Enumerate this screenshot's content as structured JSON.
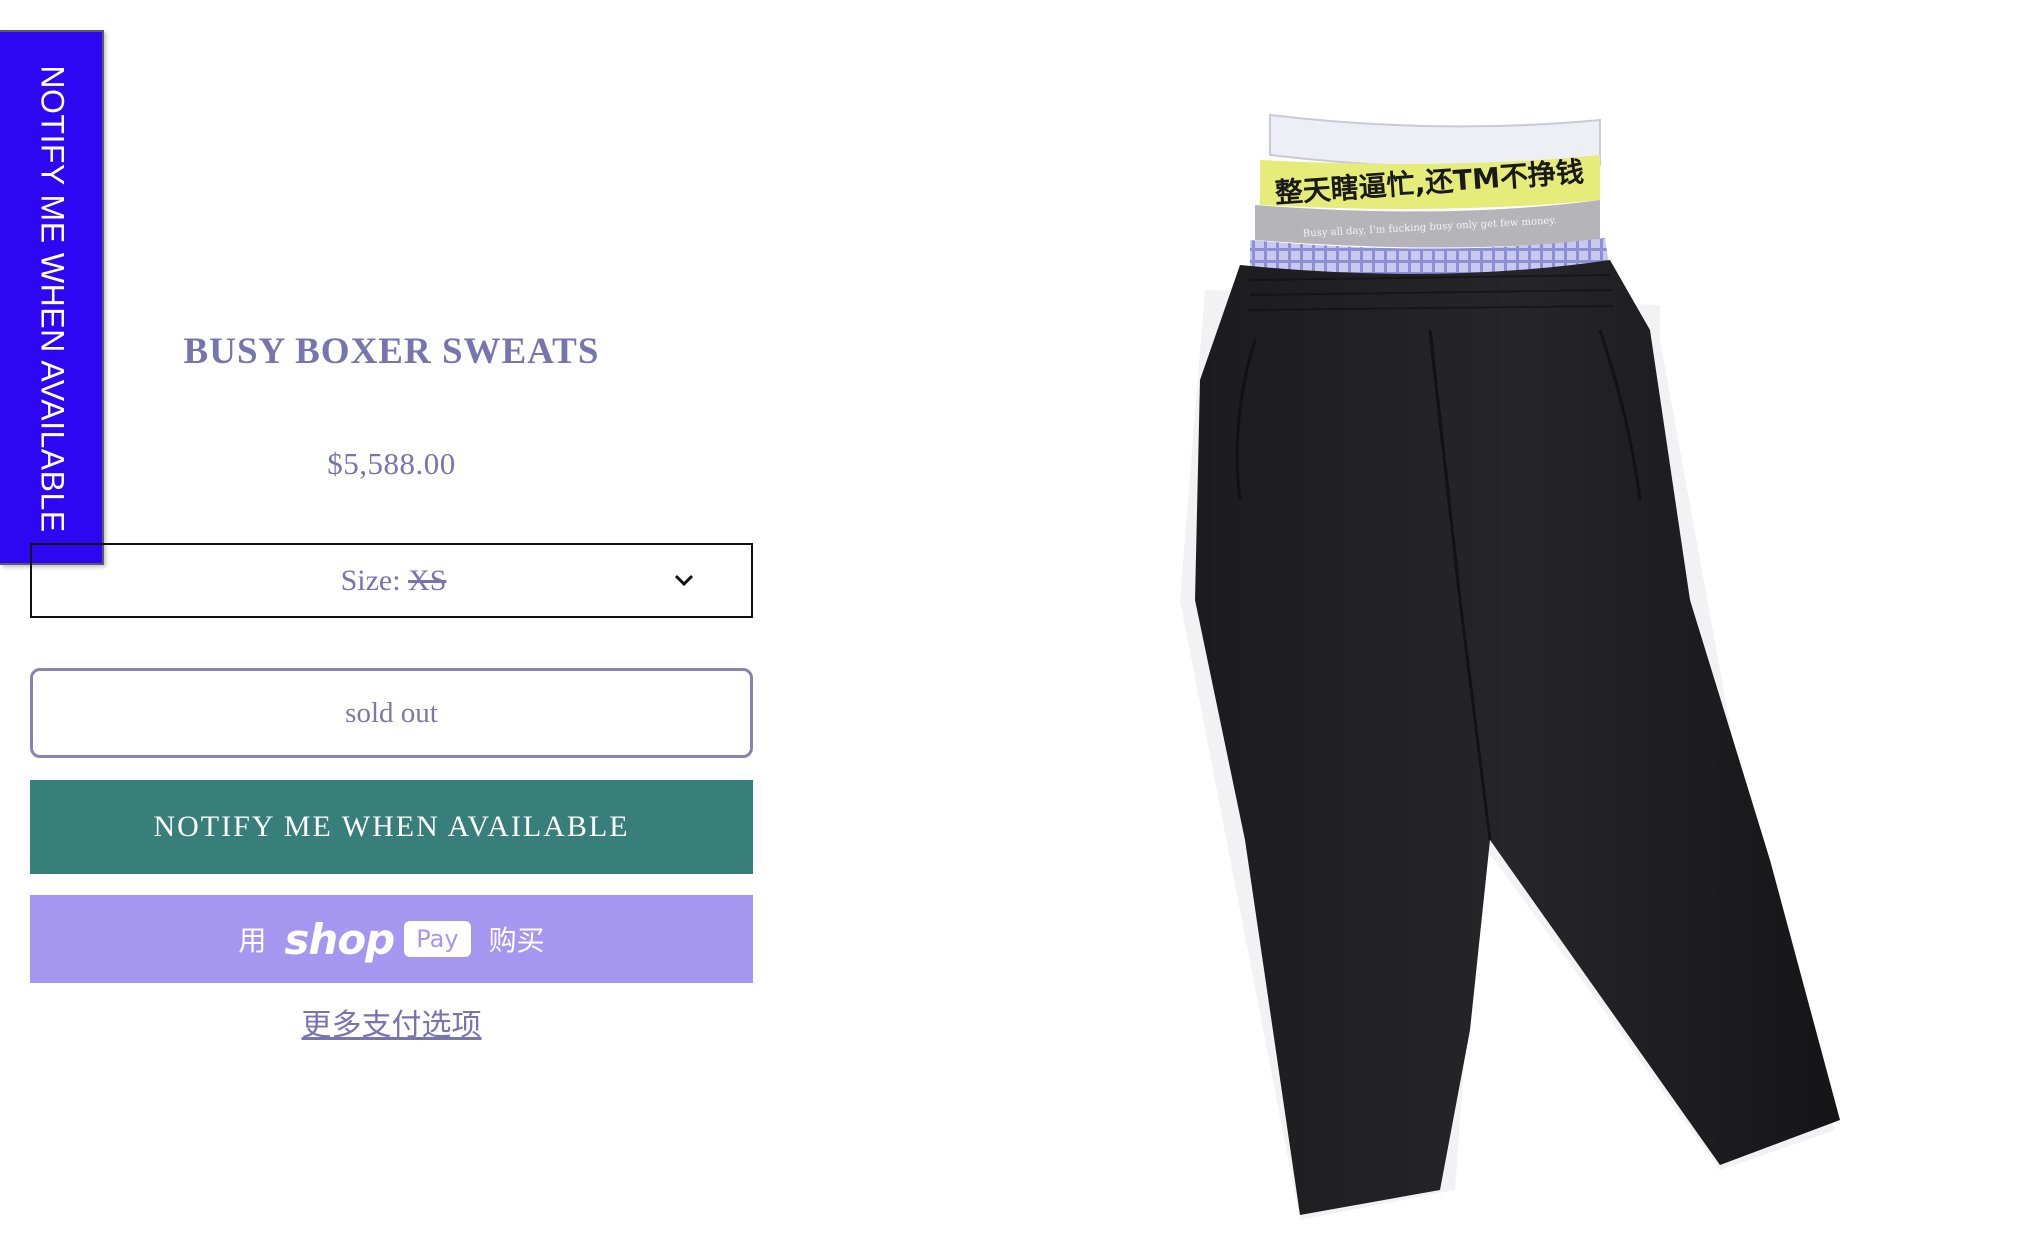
{
  "side_tab": {
    "label": "NOTIFY ME WHEN AVAILABLE"
  },
  "product": {
    "title": "BUSY BOXER SWEATS",
    "price": "$5,588.00",
    "size_label": "Size:",
    "size_value": "XS",
    "sold_out_label": "sold out",
    "notify_label": "NOTIFY ME WHEN AVAILABLE",
    "shoppay": {
      "prefix": "用",
      "logo_text": "shop",
      "pay_text": "Pay",
      "suffix": "购买"
    },
    "more_payment_options": "更多支付选项",
    "waistband_text": "整天瞎逼忙,还TM不挣钱",
    "waistband_subtext": "Busy all day, I'm fucking busy only get few money."
  },
  "colors": {
    "side_tab_bg": "#2d06f2",
    "text_accent": "#7774b0",
    "notify_bg": "#387f7b",
    "shoppay_bg": "#a597f0"
  },
  "icons": {
    "size_dropdown": "chevron-down-icon"
  }
}
